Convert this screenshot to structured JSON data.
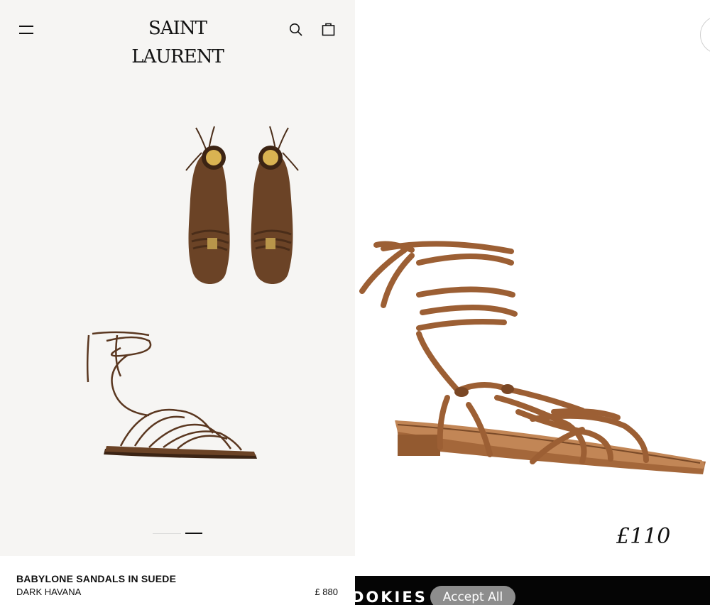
{
  "left": {
    "header": {
      "logo_text": "SAINT LAURENT",
      "menu_icon": "hamburger-menu-icon",
      "search_icon": "search-icon",
      "bag_icon": "shopping-bag-icon"
    },
    "carousel": {
      "total": 2,
      "active_index": 2
    },
    "product": {
      "name": "BABYLONE SANDALS IN SUEDE",
      "color": "DARK HAVANA",
      "price": "£ 880"
    }
  },
  "right": {
    "price_tag": "£110",
    "cookie_bar": {
      "text": "DOKIES",
      "accept_label": "Accept All"
    }
  },
  "colors": {
    "suede_brown": "#6b4326",
    "leather_tan": "#9c5f34",
    "sole_tan": "#b27748",
    "gold": "#d9b352",
    "left_bg": "#f6f5f3",
    "cookie_bg": "#050505",
    "button_grey": "#8d8d8d"
  }
}
